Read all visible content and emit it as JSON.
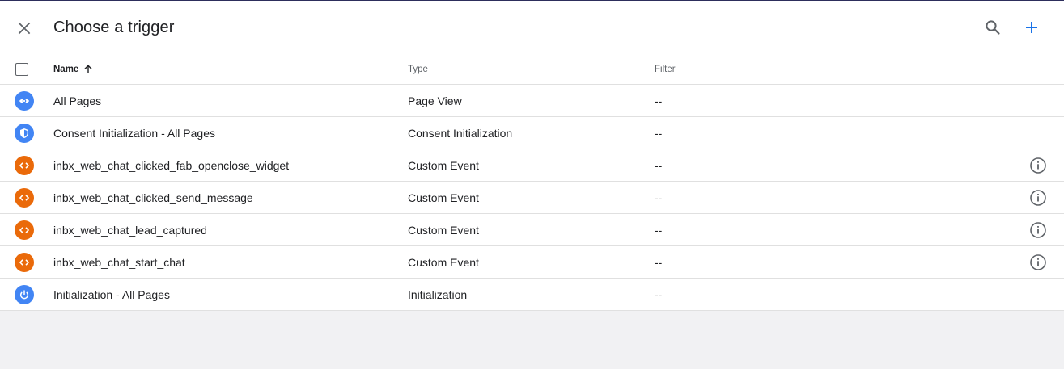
{
  "header": {
    "title": "Choose a trigger",
    "accent_color": "#1a73e8"
  },
  "columns": {
    "name": "Name",
    "type": "Type",
    "filter": "Filter"
  },
  "triggers": [
    {
      "name": "All Pages",
      "type": "Page View",
      "filter": "--",
      "icon": "eye-icon",
      "icon_color": "#4285f4",
      "info": false
    },
    {
      "name": "Consent Initialization - All Pages",
      "type": "Consent Initialization",
      "filter": "--",
      "icon": "shield-icon",
      "icon_color": "#4285f4",
      "info": false
    },
    {
      "name": "inbx_web_chat_clicked_fab_openclose_widget",
      "type": "Custom Event",
      "filter": "--",
      "icon": "code-icon",
      "icon_color": "#ea6a0a",
      "info": true
    },
    {
      "name": "inbx_web_chat_clicked_send_message",
      "type": "Custom Event",
      "filter": "--",
      "icon": "code-icon",
      "icon_color": "#ea6a0a",
      "info": true
    },
    {
      "name": "inbx_web_chat_lead_captured",
      "type": "Custom Event",
      "filter": "--",
      "icon": "code-icon",
      "icon_color": "#ea6a0a",
      "info": true
    },
    {
      "name": "inbx_web_chat_start_chat",
      "type": "Custom Event",
      "filter": "--",
      "icon": "code-icon",
      "icon_color": "#ea6a0a",
      "info": true
    },
    {
      "name": "Initialization - All Pages",
      "type": "Initialization",
      "filter": "--",
      "icon": "power-icon",
      "icon_color": "#4285f4",
      "info": false
    }
  ]
}
